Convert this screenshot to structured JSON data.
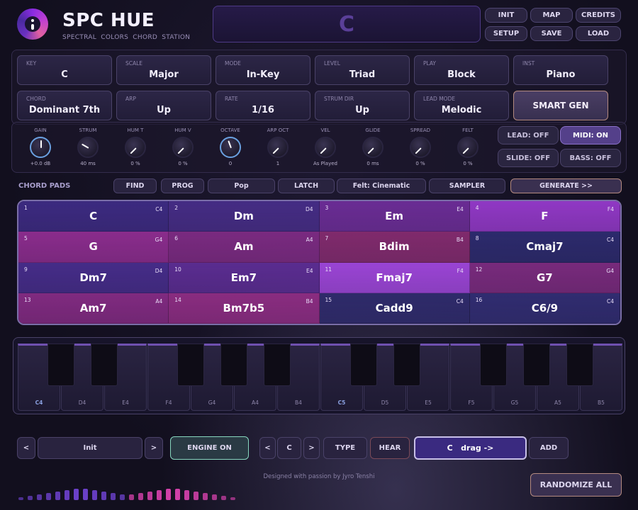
{
  "header": {
    "title": "SPC HUE",
    "subtitle": "SPECTRAL COLORS  CHORD STATION",
    "display": "C",
    "buttons": [
      "INIT",
      "MAP",
      "CREDITS",
      "SETUP",
      "SAVE",
      "LOAD"
    ]
  },
  "selectors": [
    {
      "label": "KEY",
      "value": "C"
    },
    {
      "label": "SCALE",
      "value": "Major"
    },
    {
      "label": "MODE",
      "value": "In-Key"
    },
    {
      "label": "LEVEL",
      "value": "Triad"
    },
    {
      "label": "PLAY",
      "value": "Block"
    },
    {
      "label": "INST",
      "value": "Piano"
    },
    {
      "label": "CHORD",
      "value": "Dominant 7th"
    },
    {
      "label": "ARP",
      "value": "Up"
    },
    {
      "label": "RATE",
      "value": "1/16"
    },
    {
      "label": "STRUM DIR",
      "value": "Up"
    },
    {
      "label": "LEAD MODE",
      "value": "Melodic"
    }
  ],
  "smart_gen": "SMART GEN",
  "knobs": [
    {
      "label": "GAIN",
      "value": "+0.0 dB"
    },
    {
      "label": "STRUM",
      "value": "40 ms"
    },
    {
      "label": "HUM T",
      "value": "0 %"
    },
    {
      "label": "HUM V",
      "value": "0 %"
    },
    {
      "label": "OCTAVE",
      "value": "0"
    },
    {
      "label": "ARP OCT",
      "value": "1"
    },
    {
      "label": "VEL",
      "value": "As Played"
    },
    {
      "label": "GLIDE",
      "value": "0 ms"
    },
    {
      "label": "SPREAD",
      "value": "0 %"
    },
    {
      "label": "FELT",
      "value": "0 %"
    }
  ],
  "switches": [
    {
      "label": "LEAD: OFF",
      "on": false
    },
    {
      "label": "MIDI: ON",
      "on": true
    },
    {
      "label": "SLIDE: OFF",
      "on": false
    },
    {
      "label": "BASS: OFF",
      "on": false
    }
  ],
  "pads_bar": {
    "label": "CHORD PADS",
    "buttons": [
      "FIND",
      "PROG",
      "Pop",
      "LATCH",
      "Felt: Cinematic",
      "SAMPLER"
    ],
    "generate": "GENERATE >>"
  },
  "pads": [
    {
      "n": "1",
      "chord": "C",
      "oct": "C4",
      "color": "#3c2a80"
    },
    {
      "n": "2",
      "chord": "Dm",
      "oct": "D4",
      "color": "#452c84"
    },
    {
      "n": "3",
      "chord": "Em",
      "oct": "E4",
      "color": "#6a2c94"
    },
    {
      "n": "4",
      "chord": "F",
      "oct": "F4",
      "color": "#9038c4"
    },
    {
      "n": "5",
      "chord": "G",
      "oct": "G4",
      "color": "#8a2c8c"
    },
    {
      "n": "6",
      "chord": "Am",
      "oct": "A4",
      "color": "#7a2a80"
    },
    {
      "n": "7",
      "chord": "Bdim",
      "oct": "B4",
      "color": "#802a6c"
    },
    {
      "n": "8",
      "chord": "Cmaj7",
      "oct": "C4",
      "color": "#2c2a6c"
    },
    {
      "n": "9",
      "chord": "Dm7",
      "oct": "D4",
      "color": "#452c88"
    },
    {
      "n": "10",
      "chord": "Em7",
      "oct": "E4",
      "color": "#5a2c90"
    },
    {
      "n": "11",
      "chord": "Fmaj7",
      "oct": "F4",
      "color": "#9a44d4"
    },
    {
      "n": "12",
      "chord": "G7",
      "oct": "G4",
      "color": "#782a7c"
    },
    {
      "n": "13",
      "chord": "Am7",
      "oct": "A4",
      "color": "#802a80"
    },
    {
      "n": "14",
      "chord": "Bm7b5",
      "oct": "B4",
      "color": "#8a2c80"
    },
    {
      "n": "15",
      "chord": "Cadd9",
      "oct": "C4",
      "color": "#2e2a6a"
    },
    {
      "n": "16",
      "chord": "C6/9",
      "oct": "C4",
      "color": "#302c70"
    }
  ],
  "keyboard": [
    "C4",
    "D4",
    "E4",
    "F4",
    "G4",
    "A4",
    "B4",
    "C5",
    "D5",
    "E5",
    "F5",
    "G5",
    "A5",
    "B5"
  ],
  "bottom": {
    "prev": "<",
    "preset": "Init",
    "next": ">",
    "engine": "ENGINE ON",
    "root": "C",
    "type": "TYPE",
    "hear": "HEAR",
    "drag": "C   drag ->",
    "add": "ADD",
    "randomize": "RANDOMIZE ALL",
    "credit": "Designed with passion by Jyro Tenshi"
  },
  "colors": {
    "accent": "#7a6ea8",
    "engine": "#88d8c0",
    "drag": "#3a2a80"
  }
}
